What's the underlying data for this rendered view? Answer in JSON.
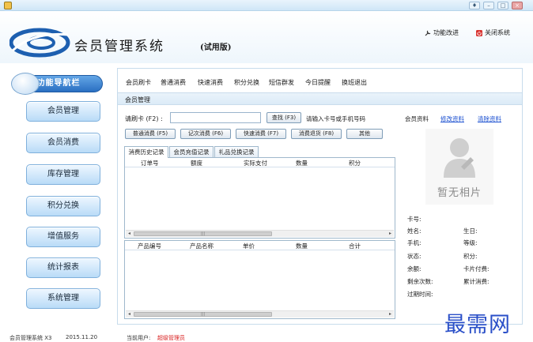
{
  "app": {
    "title": "会员管理系统",
    "edition": "(试用版)",
    "feature_improve": "功能改进",
    "close_system": "关闭系统"
  },
  "nav": {
    "header": "功能导航栏",
    "items": [
      "会员管理",
      "会员消费",
      "库存管理",
      "积分兑换",
      "增值服务",
      "统计报表",
      "系统管理"
    ]
  },
  "menu": [
    "会员刷卡",
    "普通消费",
    "快速消费",
    "积分兑换",
    "短信群发",
    "今日提醒",
    "换班退出"
  ],
  "breadcrumb": "会员管理",
  "card": {
    "label": "请刷卡 (F2) :",
    "value": "",
    "search_label": "查找 (F3)",
    "hint": "请输入卡号或手机号码"
  },
  "actions": [
    "普通消费 (F5)",
    "记次消费 (F6)",
    "快速消费 (F7)",
    "消费退货 (F8)",
    "其他"
  ],
  "tabs": [
    "消费历史记录",
    "会员充值记录",
    "礼品兑换记录"
  ],
  "history_columns": [
    "订单号",
    "额度",
    "实际支付",
    "数量",
    "积分"
  ],
  "product_columns": [
    "产品编号",
    "产品名称",
    "单价",
    "数量",
    "合计"
  ],
  "member_panel": {
    "title": "会员资料",
    "edit": "修改资料",
    "clear": "清除资料",
    "no_photo": "暂无相片",
    "fields": {
      "card_no": "卡号:",
      "name": "姓名:",
      "birthday": "生日:",
      "phone": "手机:",
      "level": "等级:",
      "status": "状态:",
      "points": "积分:",
      "balance": "余额:",
      "card_payment": "卡片付费:",
      "remaining": "剩余次数:",
      "total_spent": "累计消费:",
      "expire": "过期时间:"
    }
  },
  "status": {
    "version": "会员管理系统 X3",
    "date": "2015.11.20",
    "current_user_label": "当前用户:",
    "current_user": "超级管理员"
  },
  "watermark": "最需网",
  "colors": {
    "nav_header": "#2a6fc2",
    "nav_button": "#b9dbf7",
    "link": "#1a4fd0",
    "current_user": "#d81e1e",
    "watermark": "#2a4fc8",
    "logo": "#1d5fb0"
  },
  "icons": {
    "app": "app-icon",
    "feature_improve": "wrench-icon",
    "close_system": "power-icon",
    "avatar": "person-icon"
  }
}
